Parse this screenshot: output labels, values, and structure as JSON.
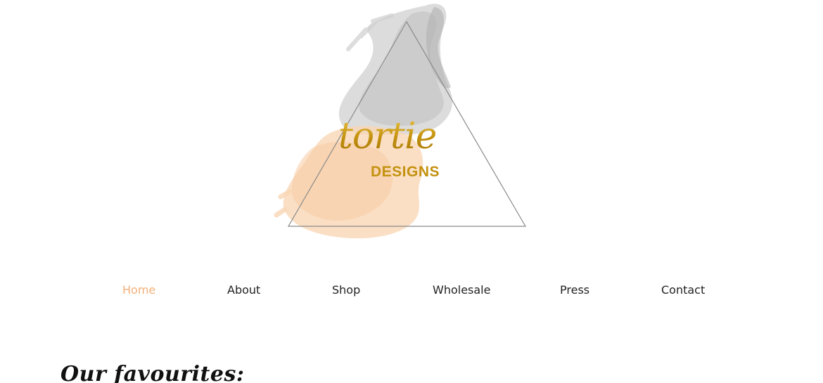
{
  "logo": {
    "script_text": "tortie",
    "sub_text": "DESIGNS",
    "gold_color": "#c4920f",
    "peach_color": "#f9d7b6",
    "grey_color": "#bdbdbd"
  },
  "nav": {
    "items": [
      {
        "label": "Home",
        "active": true
      },
      {
        "label": "About",
        "active": false
      },
      {
        "label": "Shop",
        "active": false
      },
      {
        "label": "Wholesale",
        "active": false
      },
      {
        "label": "Press",
        "active": false
      },
      {
        "label": "Contact",
        "active": false
      }
    ],
    "active_color": "#f2b077",
    "text_color": "#222222"
  },
  "section": {
    "title": "Our favourites:"
  }
}
